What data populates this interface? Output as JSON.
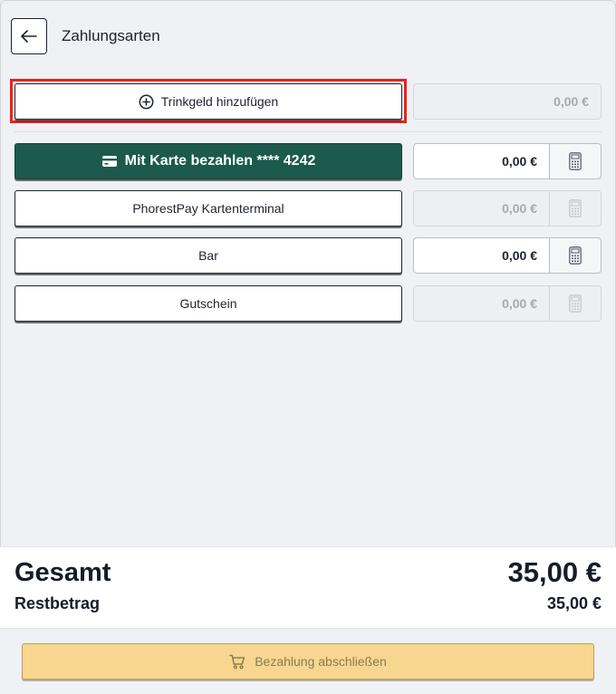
{
  "header": {
    "back_icon": "arrow-left-icon",
    "title": "Zahlungsarten"
  },
  "tip": {
    "icon": "plus-circle-icon",
    "label": "Trinkgeld hinzufügen",
    "amount": "0,00 €"
  },
  "methods": [
    {
      "label": "Mit Karte bezahlen **** 4242",
      "icon": "credit-card-icon",
      "amount": "0,00 €",
      "enabled": true,
      "primary": true
    },
    {
      "label": "PhorestPay Kartenterminal",
      "amount": "0,00 €",
      "enabled": false
    },
    {
      "label": "Bar",
      "amount": "0,00 €",
      "enabled": true
    },
    {
      "label": "Gutschein",
      "amount": "0,00 €",
      "enabled": false
    }
  ],
  "summary": {
    "total_label": "Gesamt",
    "total_value": "35,00 €",
    "rest_label": "Restbetrag",
    "rest_value": "35,00 €"
  },
  "footer": {
    "finish_icon": "shopping-cart-icon",
    "finish_label": "Bezahlung abschließen"
  },
  "colors": {
    "primary": "#1b5a4c",
    "highlight": "#e8231e",
    "finish": "#f7d68f"
  }
}
